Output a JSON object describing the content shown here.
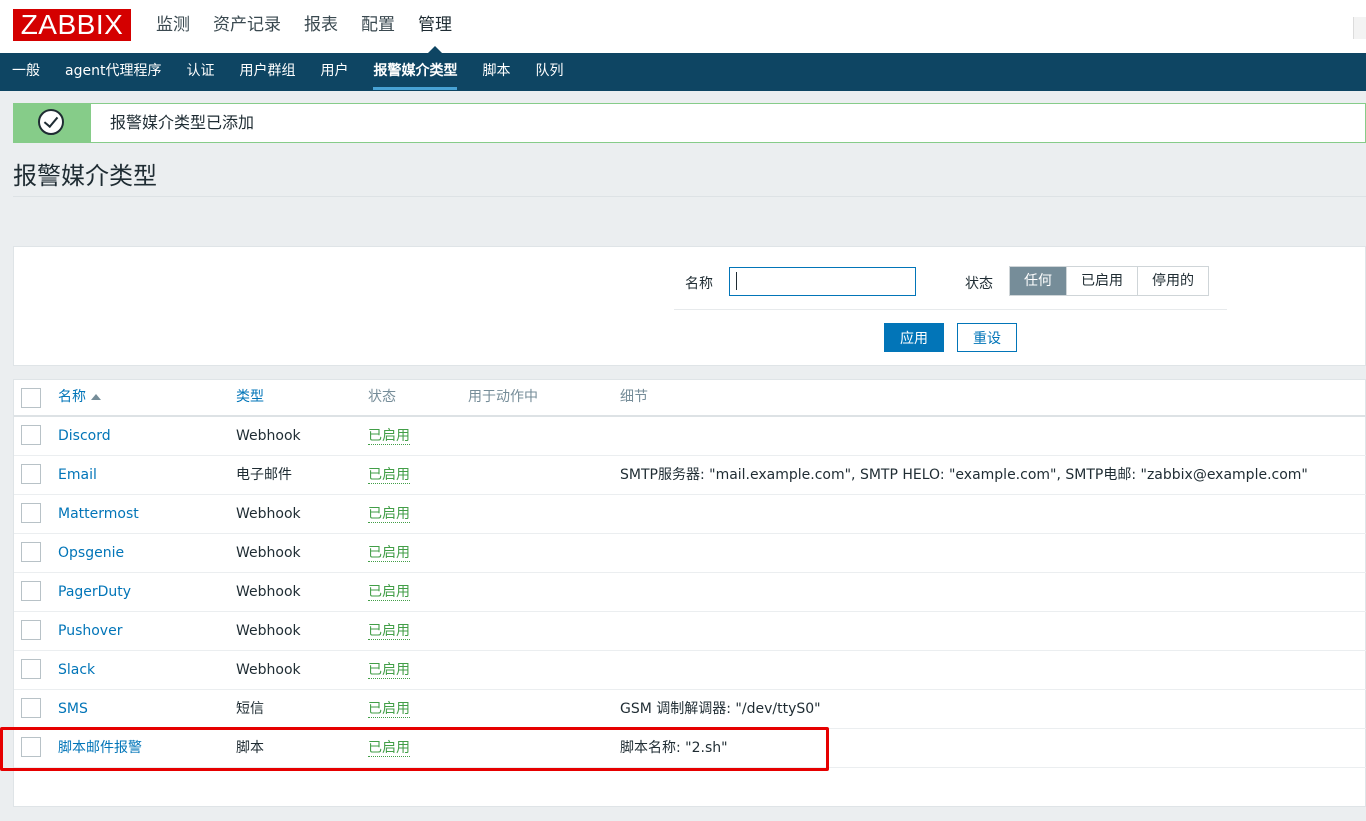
{
  "app": {
    "logo_text": "ZABBIX",
    "main_nav": [
      "监测",
      "资产记录",
      "报表",
      "配置",
      "管理"
    ],
    "active_main": "管理",
    "sub_nav": [
      "一般",
      "agent代理程序",
      "认证",
      "用户群组",
      "用户",
      "报警媒介类型",
      "脚本",
      "队列"
    ],
    "active_sub": "报警媒介类型"
  },
  "message": {
    "text": "报警媒介类型已添加",
    "icon": "check-icon"
  },
  "page_title": "报警媒介类型",
  "filter": {
    "name_label": "名称",
    "name_value": "",
    "status_label": "状态",
    "status_options": [
      "任何",
      "已启用",
      "停用的"
    ],
    "status_selected": "任何",
    "apply_label": "应用",
    "reset_label": "重设"
  },
  "table": {
    "headers": [
      "名称",
      "类型",
      "状态",
      "用于动作中",
      "细节"
    ],
    "rows": [
      {
        "name": "Discord",
        "type": "Webhook",
        "status": "已启用",
        "details": ""
      },
      {
        "name": "Email",
        "type": "电子邮件",
        "status": "已启用",
        "details": "SMTP服务器: \"mail.example.com\", SMTP HELO: \"example.com\", SMTP电邮: \"zabbix@example.com\""
      },
      {
        "name": "Mattermost",
        "type": "Webhook",
        "status": "已启用",
        "details": ""
      },
      {
        "name": "Opsgenie",
        "type": "Webhook",
        "status": "已启用",
        "details": ""
      },
      {
        "name": "PagerDuty",
        "type": "Webhook",
        "status": "已启用",
        "details": ""
      },
      {
        "name": "Pushover",
        "type": "Webhook",
        "status": "已启用",
        "details": ""
      },
      {
        "name": "Slack",
        "type": "Webhook",
        "status": "已启用",
        "details": ""
      },
      {
        "name": "SMS",
        "type": "短信",
        "status": "已启用",
        "details": "GSM 调制解调器: \"/dev/ttyS0\""
      },
      {
        "name": "脚本邮件报警",
        "type": "脚本",
        "status": "已启用",
        "details": "脚本名称: \"2.sh\""
      }
    ]
  },
  "colors": {
    "brand": "#d40000",
    "nav_bg": "#0e4563",
    "link": "#0275b8",
    "enabled": "#429e47",
    "success": "#86cc89",
    "highlight_box": "#e60000"
  }
}
